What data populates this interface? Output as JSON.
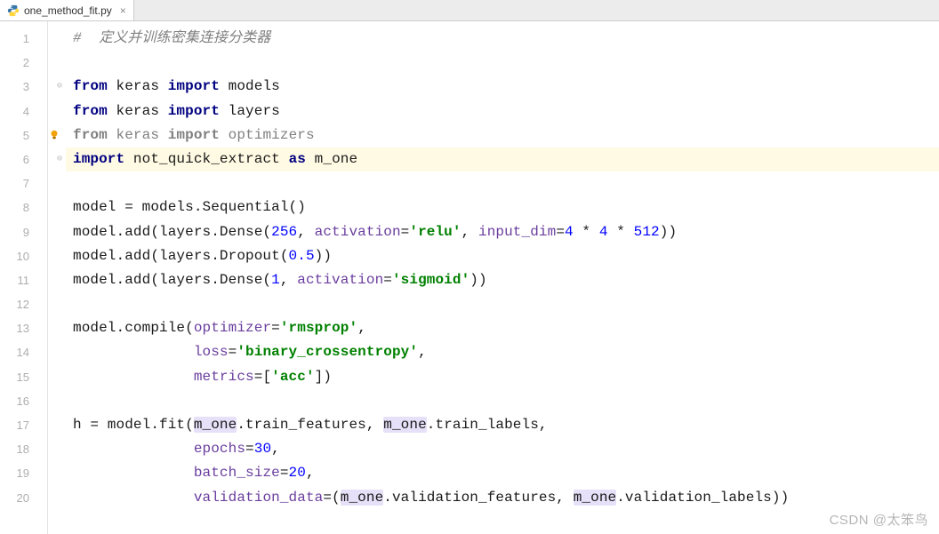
{
  "tab": {
    "filename": "one_method_fit.py",
    "close_symbol": "×"
  },
  "gutter": {
    "lines": [
      "1",
      "2",
      "3",
      "4",
      "5",
      "6",
      "7",
      "8",
      "9",
      "10",
      "11",
      "12",
      "13",
      "14",
      "15",
      "16",
      "17",
      "18",
      "19",
      "20"
    ]
  },
  "code": {
    "l1": {
      "comment": "#  定义并训练密集连接分类器"
    },
    "l3": {
      "kw_from": "from",
      "mod": " keras ",
      "kw_import": "import",
      "target": " models"
    },
    "l4": {
      "kw_from": "from",
      "mod": " keras ",
      "kw_import": "import",
      "target": " layers"
    },
    "l5": {
      "kw_from": "from",
      "mod": " keras ",
      "kw_import": "import",
      "target": " optimizers"
    },
    "l6": {
      "kw_import": "import",
      "mod": " not_quick_extract ",
      "kw_as": "as",
      "alias": " m_one"
    },
    "l8": {
      "pre": "model = models.Sequential()"
    },
    "l9": {
      "pre": "model.add(layers.Dense(",
      "num1": "256",
      "mid1": ", ",
      "kw1": "activation",
      "eq1": "=",
      "str1": "'relu'",
      "mid2": ", ",
      "kw2": "input_dim",
      "eq2": "=",
      "num2": "4",
      "mid3": " * ",
      "num3": "4",
      "mid4": " * ",
      "num4": "512",
      "post": "))"
    },
    "l10": {
      "pre": "model.add(layers.Dropout(",
      "num": "0.5",
      "post": "))"
    },
    "l11": {
      "pre": "model.add(layers.Dense(",
      "num": "1",
      "mid": ", ",
      "kw": "activation",
      "eq": "=",
      "str": "'sigmoid'",
      "post": "))"
    },
    "l13": {
      "pre": "model.compile(",
      "kw": "optimizer",
      "eq": "=",
      "str": "'rmsprop'",
      "post": ","
    },
    "l14": {
      "indent": "              ",
      "kw": "loss",
      "eq": "=",
      "str": "'binary_crossentropy'",
      "post": ","
    },
    "l15": {
      "indent": "              ",
      "kw": "metrics",
      "eq": "=[",
      "str": "'acc'",
      "post": "])"
    },
    "l17": {
      "pre": "h = model.fit(",
      "hl1": "m_one",
      "mid1": ".train_features, ",
      "hl2": "m_one",
      "mid2": ".train_labels,"
    },
    "l18": {
      "indent": "              ",
      "kw": "epochs",
      "eq": "=",
      "num": "30",
      "post": ","
    },
    "l19": {
      "indent": "              ",
      "kw": "batch_size",
      "eq": "=",
      "num": "20",
      "post": ","
    },
    "l20": {
      "indent": "              ",
      "kw": "validation_data",
      "eq": "=(",
      "hl1": "m_one",
      "mid1": ".validation_features, ",
      "hl2": "m_one",
      "mid2": ".validation_labels))"
    }
  },
  "watermark": "CSDN @太笨鸟"
}
